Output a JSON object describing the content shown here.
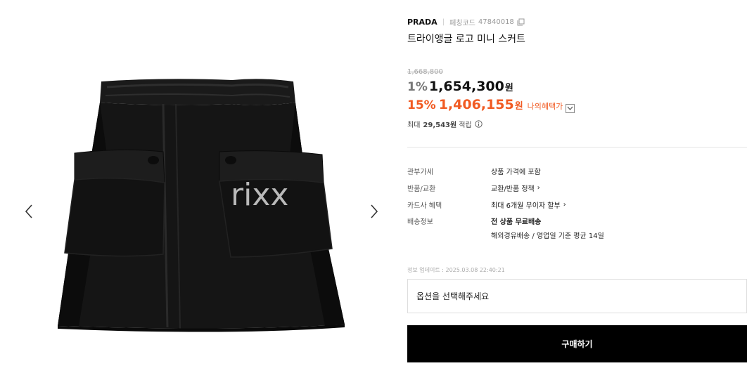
{
  "gallery": {
    "watermark": "rixx",
    "prev_icon": "chevron-left-icon",
    "next_icon": "chevron-right-icon"
  },
  "product": {
    "brand": "PRADA",
    "code_label": "페칭코드",
    "code": "47840018",
    "title": "트라이앵글 로고 미니 스커트"
  },
  "pricing": {
    "original": "1,668,800",
    "discount1_pct": "1%",
    "price1": "1,654,300",
    "won": "원",
    "discount2_pct": "15%",
    "price2": "1,406,155",
    "benefit_label": "나의혜택가",
    "points_prefix": "최대",
    "points_amount": "29,543원",
    "points_suffix": "적립",
    "accent_color": "#f15a22"
  },
  "specs": {
    "tax_label": "관부가세",
    "tax_value": "상품 가격에 포함",
    "return_label": "반품/교환",
    "return_value": "교환/반품 정책",
    "card_label": "카드사 혜택",
    "card_value": "최대 6개월 무이자 할부",
    "shipping_label": "배송정보",
    "shipping_value": "전 상품 무료배송",
    "shipping_sub": "해외경유배송 / 영업일 기준 평균 14일"
  },
  "updated": "정보 업데이트 : 2025.03.08 22:40:21",
  "option_placeholder": "옵션을 선택해주세요",
  "buy_label": "구매하기"
}
